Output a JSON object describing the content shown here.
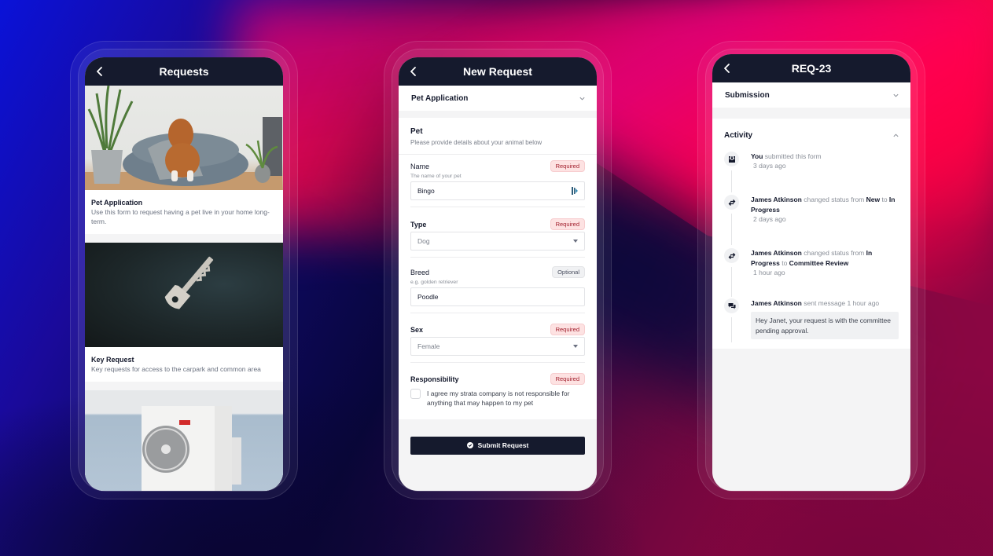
{
  "colors": {
    "topbar": "#151a2d",
    "required_bg": "#fde2e2",
    "required_text": "#a11d2b",
    "optional_bg": "#f0f1f3",
    "screen_bg": "#f4f4f5"
  },
  "screen_requests": {
    "title": "Requests",
    "back_icon": "chevron-left-icon",
    "cards": [
      {
        "title": "Pet Application",
        "description": "Use this form to request having a pet live in your home long-term.",
        "image": "dog-on-bed-photo"
      },
      {
        "title": "Key Request",
        "description": "Key requests for access to the carpark and common area",
        "image": "key-photo"
      },
      {
        "title": "",
        "description": "",
        "image": "air-conditioner-photo"
      }
    ]
  },
  "screen_new_request": {
    "title": "New Request",
    "back_icon": "chevron-left-icon",
    "form_selector": {
      "label": "Pet Application",
      "icon": "chevron-down-icon"
    },
    "section": {
      "title": "Pet",
      "subtitle": "Please provide details about your animal below"
    },
    "fields": {
      "name": {
        "label": "Name",
        "badge": "Required",
        "hint": "The name of your pet",
        "value": "Bingo"
      },
      "type": {
        "label": "Type",
        "badge": "Required",
        "value": "Dog"
      },
      "breed": {
        "label": "Breed",
        "badge": "Optional",
        "hint": "e.g. golden retriever",
        "value": "Poodle"
      },
      "sex": {
        "label": "Sex",
        "badge": "Required",
        "value": "Female"
      },
      "responsibility": {
        "label": "Responsibility",
        "badge": "Required",
        "checkbox_text": "I agree my strata company is not responsible for anything that may happen to my pet",
        "checked": false
      }
    },
    "submit_label": "Submit Request"
  },
  "screen_req23": {
    "title": "REQ-23",
    "back_icon": "chevron-left-icon",
    "submission_label": "Submission",
    "activity_label": "Activity",
    "activity": [
      {
        "icon": "inbox-download-icon",
        "actor": "You",
        "action": " submitted this form",
        "time": "3 days ago"
      },
      {
        "icon": "arrows-swap-icon",
        "actor": "James Atkinson",
        "action": " changed status from ",
        "from": "New",
        "to_word": " to ",
        "to": "In Progress",
        "time": "2 days ago"
      },
      {
        "icon": "arrows-swap-icon",
        "actor": "James Atkinson",
        "action": " changed status from ",
        "from": "In Progress",
        "to_word": " to ",
        "to": "Committee Review",
        "time": "1 hour ago"
      },
      {
        "icon": "chat-bubbles-icon",
        "actor": "James Atkinson",
        "action": " sent message 1 hour ago",
        "message": "Hey Janet, your request is with the committee pending approval."
      }
    ]
  }
}
